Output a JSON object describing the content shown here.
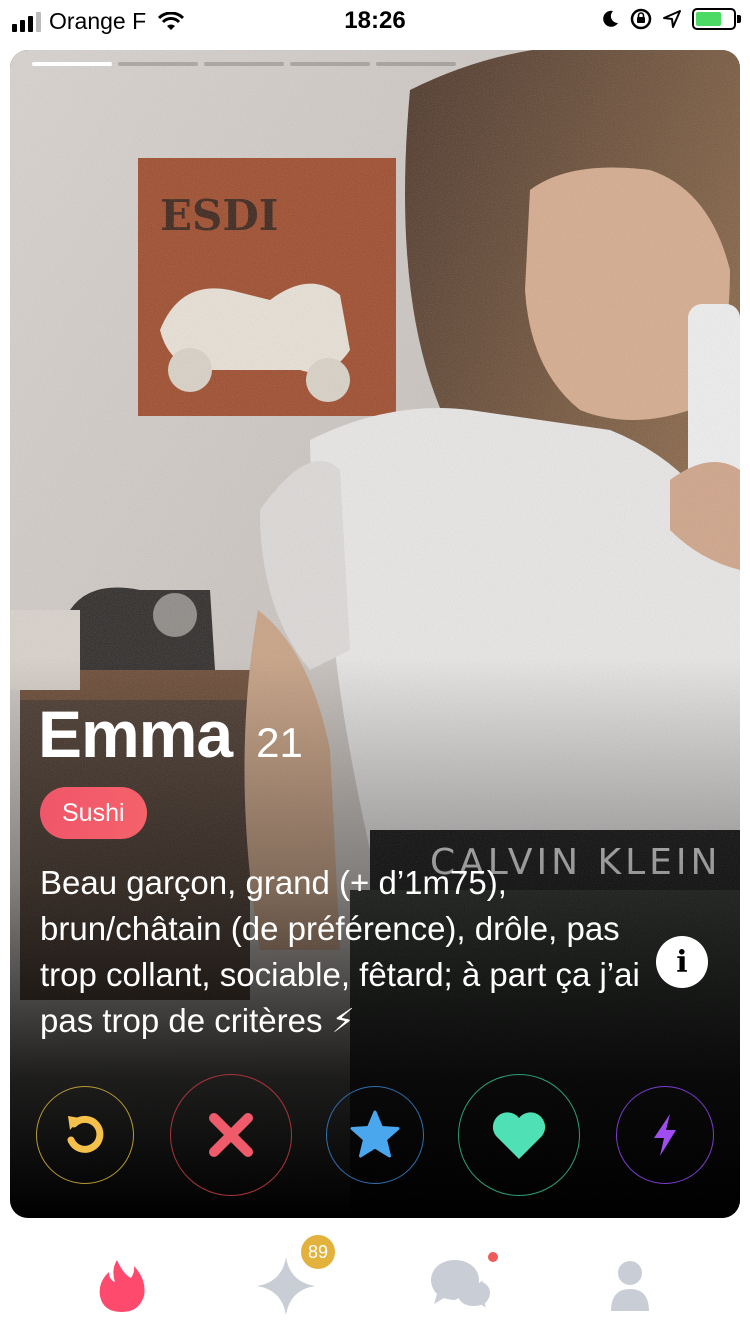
{
  "status_bar": {
    "carrier": "Orange F",
    "time": "18:26",
    "battery_level": 0.7,
    "signal_bars": 3
  },
  "card": {
    "photo_count": 5,
    "current_photo": 1,
    "name": "Emma",
    "age": "21",
    "interest": "Sushi",
    "bio": "Beau garçon, grand (+ d’1m75), brun/châtain (de préférence), drôle, pas trop collant, sociable, fêtard; à part ça j’ai pas trop de critères ⚡",
    "info_icon": "i"
  },
  "actions": [
    {
      "name": "rewind",
      "icon": "rewind-icon",
      "color": "#f5c14a"
    },
    {
      "name": "nope",
      "icon": "close-icon",
      "color": "#f05b6c"
    },
    {
      "name": "super-like",
      "icon": "star-icon",
      "color": "#4aa7ee"
    },
    {
      "name": "like",
      "icon": "heart-icon",
      "color": "#4fe0b5"
    },
    {
      "name": "boost",
      "icon": "bolt-icon",
      "color": "#a24df2"
    }
  ],
  "bottom_nav": {
    "discover_color": "#fe4a6c",
    "top_picks_badge": "89",
    "messages_has_notification": true,
    "inactive_color": "#c9ced6"
  }
}
